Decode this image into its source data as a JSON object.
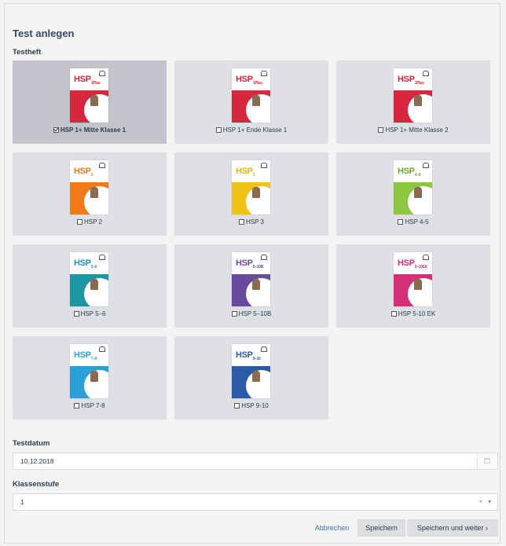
{
  "form": {
    "title": "Test anlegen",
    "testheft_label": "Testheft",
    "testdatum_label": "Testdatum",
    "testdatum_value": "10.12.2018",
    "klassenstufe_label": "Klassenstufe",
    "klassenstufe_value": "1",
    "clear_icon": "×",
    "dropdown_icon": "▾"
  },
  "tests": [
    {
      "label": "HSP 1+ Mitte Klasse 1",
      "cover": "HSP",
      "sub": "1Plus",
      "color": "#d7263d",
      "textcolor": "#d7263d",
      "checked": true
    },
    {
      "label": "HSP 1+ Ende Klasse 1",
      "cover": "HSP",
      "sub": "1Plus",
      "color": "#d7263d",
      "textcolor": "#d7263d",
      "checked": false
    },
    {
      "label": "HSP 1+ Mitte Klasse 2",
      "cover": "HSP",
      "sub": "1Plus",
      "color": "#d7263d",
      "textcolor": "#d7263d",
      "checked": false
    },
    {
      "label": "HSP 2",
      "cover": "HSP",
      "sub": "2",
      "color": "#f07a1a",
      "textcolor": "#f07a1a",
      "checked": false
    },
    {
      "label": "HSP 3",
      "cover": "HSP",
      "sub": "3",
      "color": "#f2c315",
      "textcolor": "#e3b20f",
      "checked": false
    },
    {
      "label": "HSP 4-5",
      "cover": "HSP",
      "sub": "4–5",
      "color": "#8dc63f",
      "textcolor": "#6aa82b",
      "checked": false
    },
    {
      "label": "HSP 5–6",
      "cover": "HSP",
      "sub": "5–6",
      "color": "#1c96a3",
      "textcolor": "#1c96a3",
      "checked": false
    },
    {
      "label": "HSP 5–10B",
      "cover": "HSP",
      "sub": "5–10B",
      "color": "#6a4a9c",
      "textcolor": "#6a4a9c",
      "checked": false
    },
    {
      "label": "HSP 5-10 EK",
      "cover": "HSP",
      "sub": "5–10EK",
      "color": "#d6307a",
      "textcolor": "#d6307a",
      "checked": false
    },
    {
      "label": "HSP 7-8",
      "cover": "HSP",
      "sub": "7–8",
      "color": "#2a9fd8",
      "textcolor": "#2a9fd8",
      "checked": false
    },
    {
      "label": "HSP 9-10",
      "cover": "HSP",
      "sub": "9–10",
      "color": "#2b5aa8",
      "textcolor": "#2b5aa8",
      "checked": false
    }
  ],
  "buttons": {
    "cancel": "Abbrechen",
    "save": "Speichern",
    "save_next": "Speichern und weiter ›"
  }
}
